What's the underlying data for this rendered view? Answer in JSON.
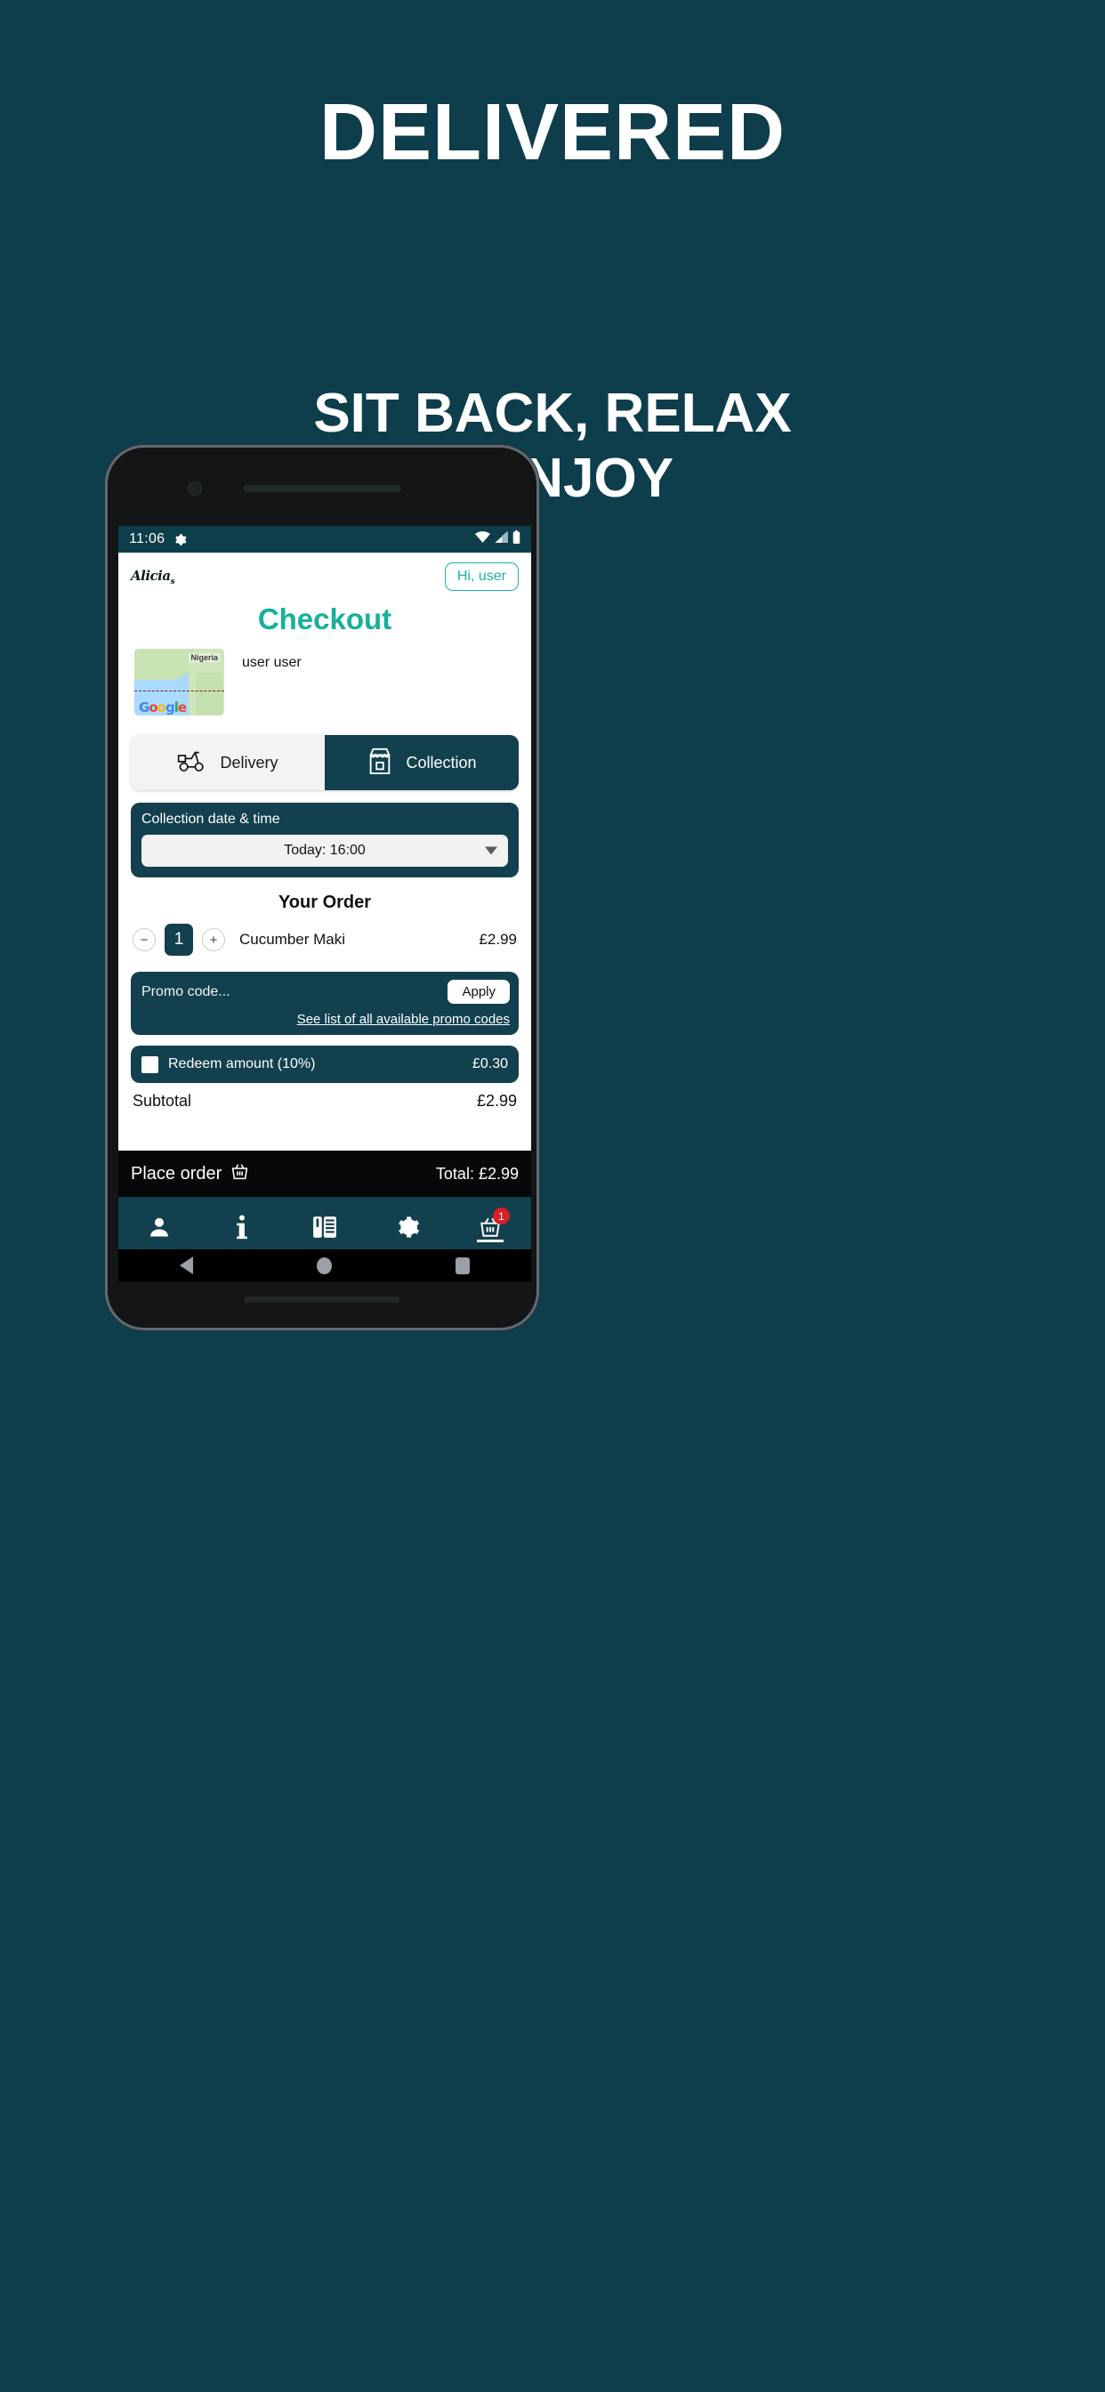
{
  "promo": {
    "headline": "DELIVERED",
    "subhead_line1": "SIT BACK, RELAX",
    "subhead_line2": "& ENJOY",
    "background_color": "#0e3d4b",
    "text_color": "#ffffff"
  },
  "statusbar": {
    "time": "11:06",
    "gear_icon": "gear-icon",
    "wifi_icon": "wifi-icon",
    "signal_icon": "signal-icon",
    "battery_icon": "battery-icon"
  },
  "app_header": {
    "logo_text": "Alicia",
    "logo_sub": "s",
    "account_button": "Hi, user"
  },
  "page": {
    "title": "Checkout",
    "accent_color": "#17b09b"
  },
  "address": {
    "map_label": "Nigeria",
    "map_provider": "Google",
    "name": "user user"
  },
  "mode_tabs": [
    {
      "label": "Delivery",
      "icon": "scooter-icon",
      "active": false
    },
    {
      "label": "Collection",
      "icon": "store-bag-icon",
      "active": true
    }
  ],
  "collection": {
    "panel_label": "Collection date & time",
    "selected_slot": "Today: 16:00",
    "caret_icon": "chevron-down-icon"
  },
  "order": {
    "section_title": "Your Order",
    "items": [
      {
        "decrement": "−",
        "quantity": "1",
        "increment": "+",
        "name": "Cucumber Maki",
        "price": "£2.99"
      }
    ]
  },
  "promo_code": {
    "placeholder": "Promo code...",
    "apply_label": "Apply",
    "list_link": "See list of all available promo codes"
  },
  "redeem": {
    "label": "Redeem amount (10%)",
    "amount": "£0.30",
    "checked": false
  },
  "totals": {
    "subtotal_label": "Subtotal",
    "subtotal_value": "£2.99"
  },
  "place_order": {
    "label": "Place order",
    "icon": "basket-icon",
    "total_label": "Total: £2.99"
  },
  "bottom_nav": [
    {
      "name": "account",
      "icon": "person-icon",
      "badge": ""
    },
    {
      "name": "info",
      "icon": "info-icon",
      "badge": ""
    },
    {
      "name": "menu",
      "icon": "cutlery-menu-icon",
      "badge": ""
    },
    {
      "name": "settings",
      "icon": "gear-icon",
      "badge": ""
    },
    {
      "name": "basket",
      "icon": "basket-icon",
      "badge": "1"
    }
  ],
  "android_nav": {
    "back": "back-triangle-icon",
    "home": "home-circle-icon",
    "recents": "recents-square-icon"
  }
}
